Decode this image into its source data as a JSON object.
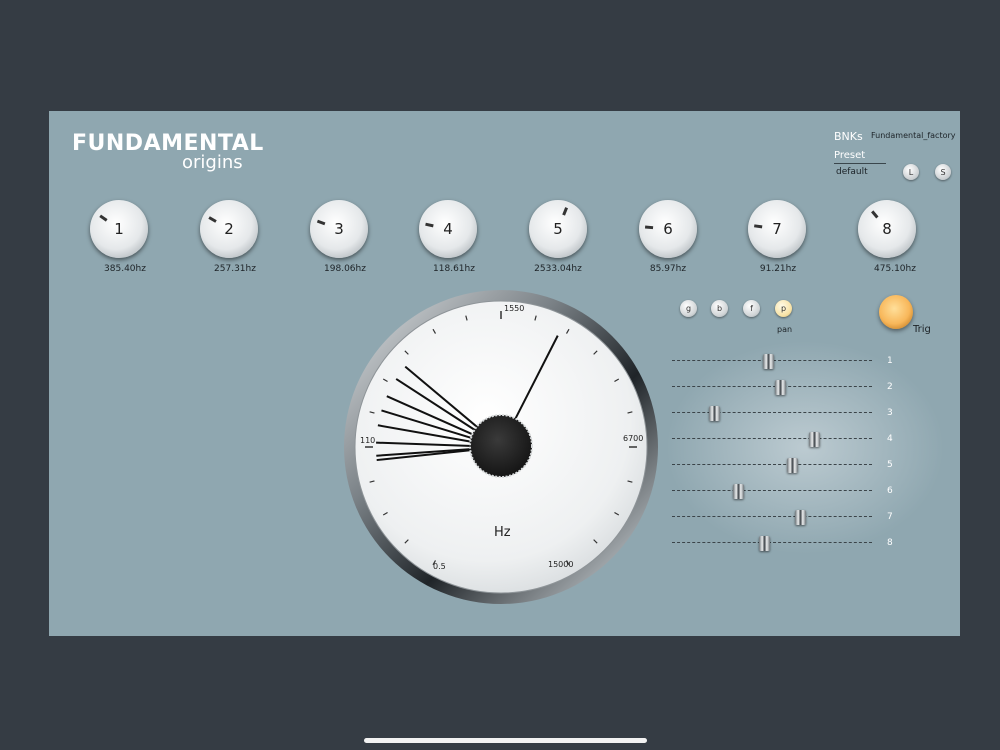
{
  "brand": {
    "line1": "FUNDAMENTAL",
    "line2": "origins"
  },
  "bank": {
    "label": "BNKs",
    "value": "Fundamental_factory"
  },
  "preset": {
    "label": "Preset",
    "value": "default",
    "load_label": "L",
    "save_label": "S"
  },
  "knobs": [
    {
      "label": "1",
      "freq": "385.40hz",
      "angle": -55
    },
    {
      "label": "2",
      "freq": "257.31hz",
      "angle": -60
    },
    {
      "label": "3",
      "freq": "198.06hz",
      "angle": -70
    },
    {
      "label": "4",
      "freq": "118.61hz",
      "angle": -78
    },
    {
      "label": "5",
      "freq": "2533.04hz",
      "angle": 22
    },
    {
      "label": "6",
      "freq": "85.97hz",
      "angle": -85
    },
    {
      "label": "7",
      "freq": "91.21hz",
      "angle": -82
    },
    {
      "label": "8",
      "freq": "475.10hz",
      "angle": -40
    }
  ],
  "modes": [
    {
      "label": "g",
      "active": false
    },
    {
      "label": "b",
      "active": false
    },
    {
      "label": "f",
      "active": false
    },
    {
      "label": "p",
      "active": true
    }
  ],
  "mode_caption": "pan",
  "trigger": {
    "label": "Trig"
  },
  "pan_sliders": [
    {
      "label": "1",
      "position": 0.48
    },
    {
      "label": "2",
      "position": 0.54
    },
    {
      "label": "3",
      "position": 0.21
    },
    {
      "label": "4",
      "position": 0.71
    },
    {
      "label": "5",
      "position": 0.6
    },
    {
      "label": "6",
      "position": 0.33
    },
    {
      "label": "7",
      "position": 0.64
    },
    {
      "label": "8",
      "position": 0.46
    }
  ],
  "dial": {
    "unit": "Hz",
    "scale_labels": [
      "1550",
      "110",
      "6700",
      "0.5",
      "15000"
    ],
    "needle_angles": [
      27,
      -50,
      -57,
      -66,
      -73,
      -80,
      -88,
      -94,
      -96
    ]
  },
  "colors": {
    "panel": "#8fa7b0",
    "frame": "#353c44",
    "trigger": "#f8b75a",
    "active_mode": "#f7e2a6"
  }
}
